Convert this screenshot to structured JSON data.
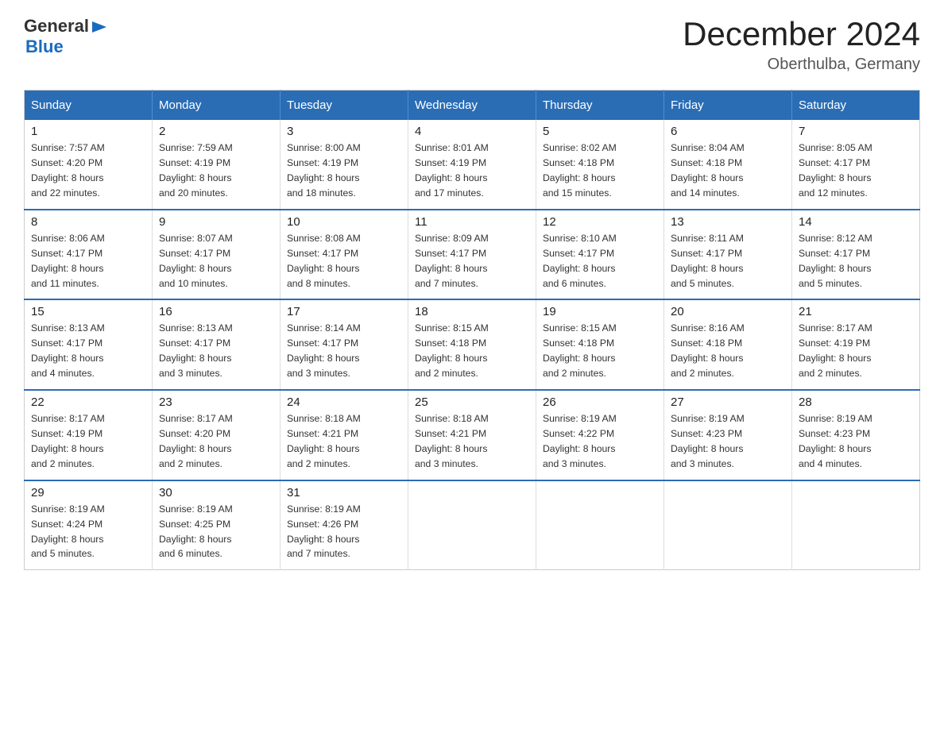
{
  "header": {
    "logo_general": "General",
    "logo_blue": "Blue",
    "month": "December 2024",
    "location": "Oberthulba, Germany"
  },
  "weekdays": [
    "Sunday",
    "Monday",
    "Tuesday",
    "Wednesday",
    "Thursday",
    "Friday",
    "Saturday"
  ],
  "weeks": [
    [
      {
        "day": "1",
        "sunrise": "7:57 AM",
        "sunset": "4:20 PM",
        "daylight": "8 hours and 22 minutes."
      },
      {
        "day": "2",
        "sunrise": "7:59 AM",
        "sunset": "4:19 PM",
        "daylight": "8 hours and 20 minutes."
      },
      {
        "day": "3",
        "sunrise": "8:00 AM",
        "sunset": "4:19 PM",
        "daylight": "8 hours and 18 minutes."
      },
      {
        "day": "4",
        "sunrise": "8:01 AM",
        "sunset": "4:19 PM",
        "daylight": "8 hours and 17 minutes."
      },
      {
        "day": "5",
        "sunrise": "8:02 AM",
        "sunset": "4:18 PM",
        "daylight": "8 hours and 15 minutes."
      },
      {
        "day": "6",
        "sunrise": "8:04 AM",
        "sunset": "4:18 PM",
        "daylight": "8 hours and 14 minutes."
      },
      {
        "day": "7",
        "sunrise": "8:05 AM",
        "sunset": "4:17 PM",
        "daylight": "8 hours and 12 minutes."
      }
    ],
    [
      {
        "day": "8",
        "sunrise": "8:06 AM",
        "sunset": "4:17 PM",
        "daylight": "8 hours and 11 minutes."
      },
      {
        "day": "9",
        "sunrise": "8:07 AM",
        "sunset": "4:17 PM",
        "daylight": "8 hours and 10 minutes."
      },
      {
        "day": "10",
        "sunrise": "8:08 AM",
        "sunset": "4:17 PM",
        "daylight": "8 hours and 8 minutes."
      },
      {
        "day": "11",
        "sunrise": "8:09 AM",
        "sunset": "4:17 PM",
        "daylight": "8 hours and 7 minutes."
      },
      {
        "day": "12",
        "sunrise": "8:10 AM",
        "sunset": "4:17 PM",
        "daylight": "8 hours and 6 minutes."
      },
      {
        "day": "13",
        "sunrise": "8:11 AM",
        "sunset": "4:17 PM",
        "daylight": "8 hours and 5 minutes."
      },
      {
        "day": "14",
        "sunrise": "8:12 AM",
        "sunset": "4:17 PM",
        "daylight": "8 hours and 5 minutes."
      }
    ],
    [
      {
        "day": "15",
        "sunrise": "8:13 AM",
        "sunset": "4:17 PM",
        "daylight": "8 hours and 4 minutes."
      },
      {
        "day": "16",
        "sunrise": "8:13 AM",
        "sunset": "4:17 PM",
        "daylight": "8 hours and 3 minutes."
      },
      {
        "day": "17",
        "sunrise": "8:14 AM",
        "sunset": "4:17 PM",
        "daylight": "8 hours and 3 minutes."
      },
      {
        "day": "18",
        "sunrise": "8:15 AM",
        "sunset": "4:18 PM",
        "daylight": "8 hours and 2 minutes."
      },
      {
        "day": "19",
        "sunrise": "8:15 AM",
        "sunset": "4:18 PM",
        "daylight": "8 hours and 2 minutes."
      },
      {
        "day": "20",
        "sunrise": "8:16 AM",
        "sunset": "4:18 PM",
        "daylight": "8 hours and 2 minutes."
      },
      {
        "day": "21",
        "sunrise": "8:17 AM",
        "sunset": "4:19 PM",
        "daylight": "8 hours and 2 minutes."
      }
    ],
    [
      {
        "day": "22",
        "sunrise": "8:17 AM",
        "sunset": "4:19 PM",
        "daylight": "8 hours and 2 minutes."
      },
      {
        "day": "23",
        "sunrise": "8:17 AM",
        "sunset": "4:20 PM",
        "daylight": "8 hours and 2 minutes."
      },
      {
        "day": "24",
        "sunrise": "8:18 AM",
        "sunset": "4:21 PM",
        "daylight": "8 hours and 2 minutes."
      },
      {
        "day": "25",
        "sunrise": "8:18 AM",
        "sunset": "4:21 PM",
        "daylight": "8 hours and 3 minutes."
      },
      {
        "day": "26",
        "sunrise": "8:19 AM",
        "sunset": "4:22 PM",
        "daylight": "8 hours and 3 minutes."
      },
      {
        "day": "27",
        "sunrise": "8:19 AM",
        "sunset": "4:23 PM",
        "daylight": "8 hours and 3 minutes."
      },
      {
        "day": "28",
        "sunrise": "8:19 AM",
        "sunset": "4:23 PM",
        "daylight": "8 hours and 4 minutes."
      }
    ],
    [
      {
        "day": "29",
        "sunrise": "8:19 AM",
        "sunset": "4:24 PM",
        "daylight": "8 hours and 5 minutes."
      },
      {
        "day": "30",
        "sunrise": "8:19 AM",
        "sunset": "4:25 PM",
        "daylight": "8 hours and 6 minutes."
      },
      {
        "day": "31",
        "sunrise": "8:19 AM",
        "sunset": "4:26 PM",
        "daylight": "8 hours and 7 minutes."
      },
      null,
      null,
      null,
      null
    ]
  ],
  "labels": {
    "sunrise": "Sunrise:",
    "sunset": "Sunset:",
    "daylight": "Daylight:"
  }
}
